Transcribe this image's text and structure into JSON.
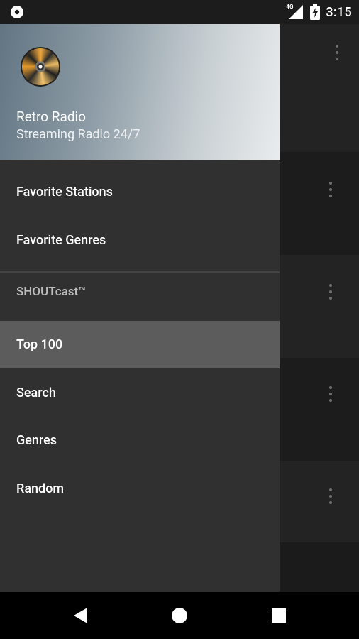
{
  "status_bar": {
    "network_label": "4G",
    "time": "3:15"
  },
  "drawer": {
    "header": {
      "title": "Retro Radio",
      "subtitle": "Streaming Radio 24/7"
    },
    "items": [
      {
        "label": "Favorite Stations"
      },
      {
        "label": "Favorite Genres"
      }
    ],
    "section_header": "SHOUTcast™",
    "section_items": [
      {
        "label": "Top 100",
        "active": true
      },
      {
        "label": "Search"
      },
      {
        "label": "Genres"
      },
      {
        "label": "Random"
      }
    ]
  },
  "colors": {
    "drawer_bg": "#303030",
    "active_item_bg": "#5c5c5c",
    "status_bar_bg": "#1c1c1c",
    "nav_bar_bg": "#000000"
  }
}
